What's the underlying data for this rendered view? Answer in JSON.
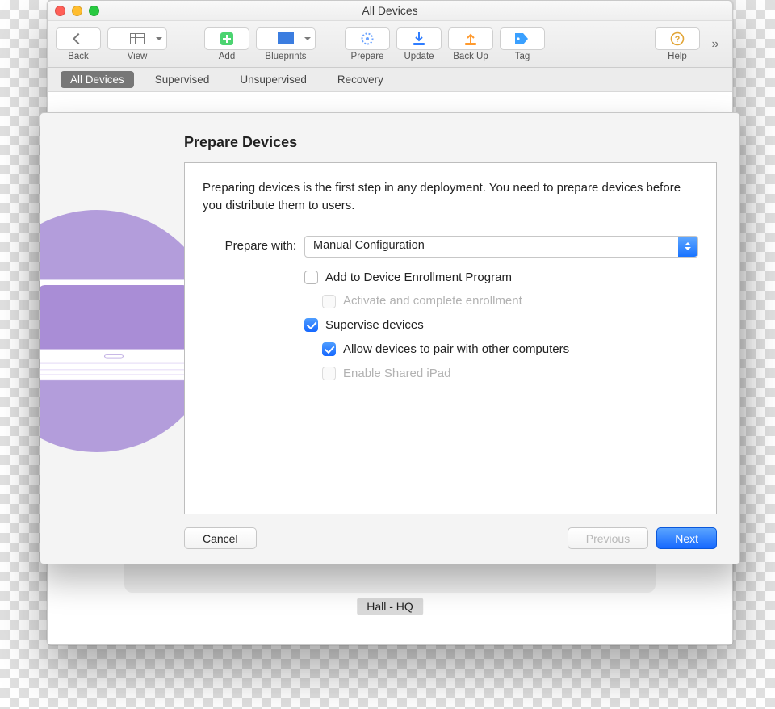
{
  "window": {
    "title": "All Devices"
  },
  "toolbar": {
    "items": [
      {
        "label": "Back"
      },
      {
        "label": "View"
      },
      {
        "label": "Add"
      },
      {
        "label": "Blueprints"
      },
      {
        "label": "Prepare"
      },
      {
        "label": "Update"
      },
      {
        "label": "Back Up"
      },
      {
        "label": "Tag"
      },
      {
        "label": "Help"
      }
    ]
  },
  "scopebar": {
    "items": [
      {
        "label": "All Devices",
        "active": true
      },
      {
        "label": "Supervised"
      },
      {
        "label": "Unsupervised"
      },
      {
        "label": "Recovery"
      }
    ]
  },
  "bg_device_label": "Hall - HQ",
  "sheet": {
    "title": "Prepare Devices",
    "description": "Preparing devices is the first step in any deployment. You need to prepare devices before you distribute them to users.",
    "prepare_with_label": "Prepare with:",
    "prepare_with_value": "Manual Configuration",
    "options": {
      "add_dep": {
        "label": "Add to Device Enrollment Program",
        "checked": false,
        "enabled": true
      },
      "activate": {
        "label": "Activate and complete enrollment",
        "checked": false,
        "enabled": false
      },
      "supervise": {
        "label": "Supervise devices",
        "checked": true,
        "enabled": true
      },
      "pair": {
        "label": "Allow devices to pair with other computers",
        "checked": true,
        "enabled": true
      },
      "shared": {
        "label": "Enable Shared iPad",
        "checked": false,
        "enabled": false
      }
    },
    "buttons": {
      "cancel": "Cancel",
      "previous": "Previous",
      "next": "Next"
    }
  }
}
